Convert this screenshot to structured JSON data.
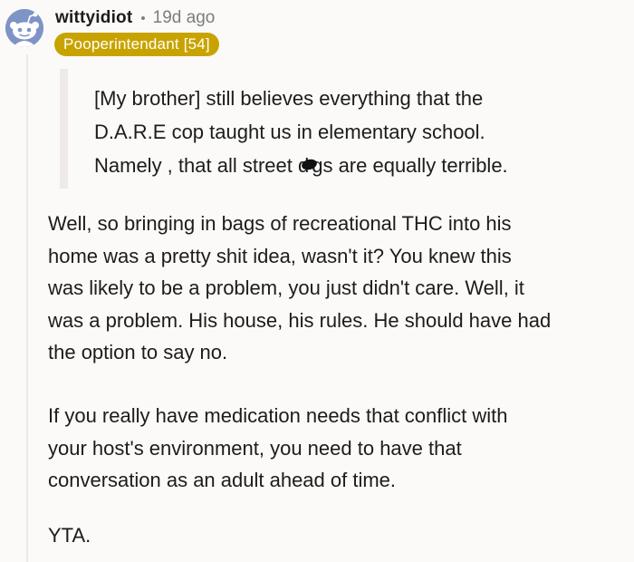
{
  "comment": {
    "username": "wittyidiot",
    "separator": "•",
    "age": "19d ago",
    "flair": "Pooperintendant [54]",
    "quote": {
      "line1": "[My brother] still believes everything that the",
      "line2": "D.A.R.E cop taught us in elementary school.",
      "line3_before": "Namely , that all street d",
      "line3_after": "gs are equally terrible."
    },
    "paragraph1": [
      "Well, so bringing in bags of recreational THC into his",
      "home was a pretty shit idea, wasn't it? You knew this",
      "was likely to be a problem, you just didn't care. Well, it",
      "was a problem. His house, his rules. He should have had",
      "the option to say no."
    ],
    "paragraph2": [
      "If you really have medication needs that conflict with",
      "your host's environment, you need to have that",
      "conversation as an adult ahead of time."
    ],
    "paragraph3": "YTA."
  },
  "icons": {
    "avatar": "snoo-avatar-icon",
    "censor": "censor-scribble-icon"
  },
  "colors": {
    "background": "#fbfaf8",
    "flair_bg": "#c8a300",
    "avatar_bg": "#7f94c6",
    "meta_text": "#7c7c7c",
    "quote_bar": "#efe9e7"
  }
}
